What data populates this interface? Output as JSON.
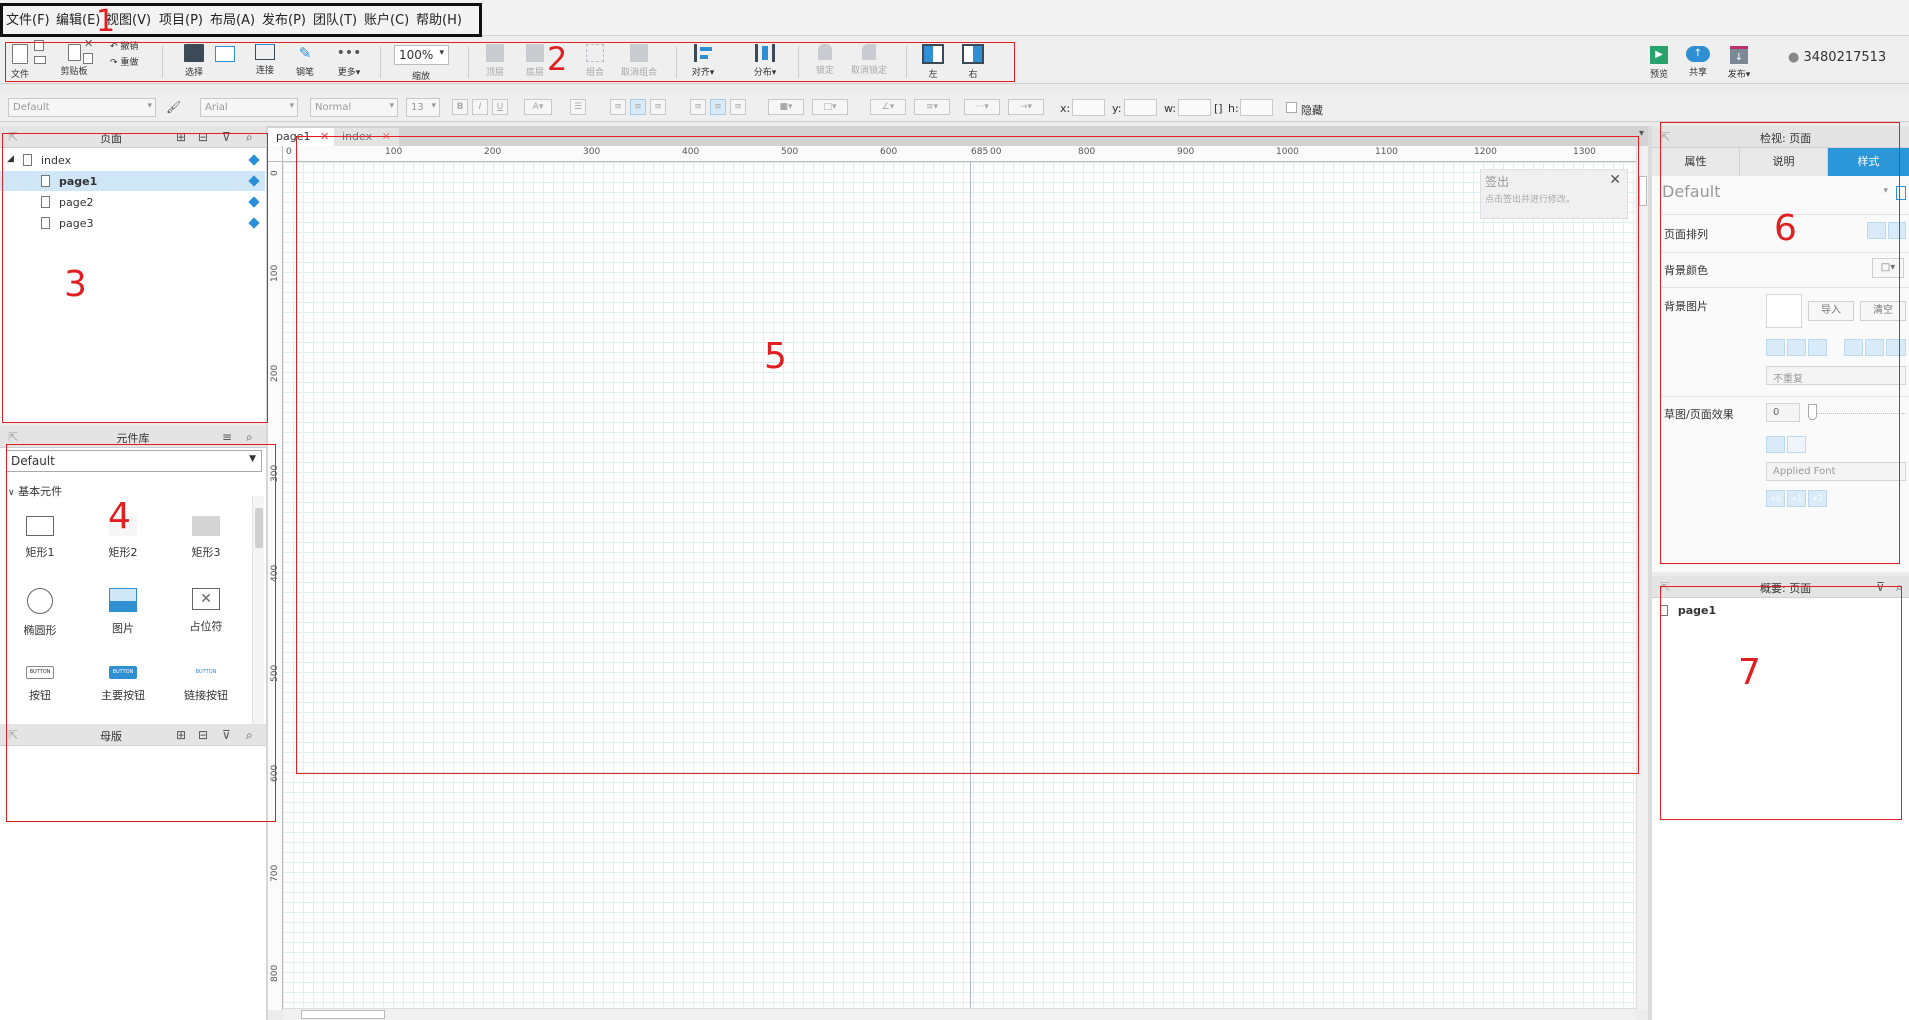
{
  "menu": [
    "文件(F)",
    "编辑(E)",
    "视图(V)",
    "项目(P)",
    "布局(A)",
    "发布(P)",
    "团队(T)",
    "账户(C)",
    "帮助(H)"
  ],
  "toolbar": {
    "file": "文件",
    "clipboard": "剪贴板",
    "undo": "撤销",
    "redo": "重做",
    "select": "选择",
    "connect": "连接",
    "pen": "钢笔",
    "more": "更多▾",
    "zoom_value": "100%",
    "zoom_label": "缩放",
    "top": "顶层",
    "bottom": "底层",
    "group": "组合",
    "ungroup": "取消组合",
    "align": "对齐▾",
    "distribute": "分布▾",
    "lock": "锁定",
    "unlock": "取消锁定",
    "left": "左",
    "right": "右",
    "preview": "预览",
    "share": "共享",
    "publish": "发布▾",
    "user": "3480217513"
  },
  "formatbar": {
    "style": "Default",
    "font": "Arial",
    "weight": "Normal",
    "size": "13",
    "x_label": "x:",
    "y_label": "y:",
    "w_label": "w:",
    "h_label": "h:",
    "hidden_label": "隐藏"
  },
  "pages_panel": {
    "title": "页面",
    "items": [
      {
        "label": "index",
        "level": 0,
        "selected": false,
        "bold": false
      },
      {
        "label": "page1",
        "level": 1,
        "selected": true,
        "bold": true
      },
      {
        "label": "page2",
        "level": 1,
        "selected": false,
        "bold": false
      },
      {
        "label": "page3",
        "level": 1,
        "selected": false,
        "bold": false
      }
    ]
  },
  "library_panel": {
    "title": "元件库",
    "selected_library": "Default",
    "group": "基本元件",
    "widgets": [
      "矩形1",
      "矩形2",
      "矩形3",
      "椭圆形",
      "图片",
      "占位符",
      "按钮",
      "主要按钮",
      "链接按钮"
    ],
    "button_text": "BUTTON"
  },
  "masters_panel": {
    "title": "母版"
  },
  "canvas": {
    "tabs": [
      {
        "label": "page1",
        "active": true
      },
      {
        "label": "index",
        "active": false
      }
    ],
    "ruler_x": [
      "0",
      "100",
      "200",
      "300",
      "400",
      "500",
      "600",
      "685",
      "00",
      "800",
      "900",
      "1000",
      "1100",
      "1200",
      "1300"
    ],
    "ruler_y": [
      "0",
      "100",
      "200",
      "300",
      "400",
      "500",
      "600",
      "700",
      "800"
    ],
    "notice_title": "签出",
    "notice_text": "点击签出并进行修改。"
  },
  "inspector": {
    "title": "检视: 页面",
    "tabs": [
      "属性",
      "说明",
      "样式"
    ],
    "active_tab": 2,
    "style_value": "Default",
    "page_align": "页面排列",
    "bg_color": "背景颜色",
    "bg_image": "背景图片",
    "import": "导入",
    "clear": "清空",
    "repeat": "不重复",
    "sketch_effect": "草图/页面效果",
    "sketch_value": "0",
    "font_value": "Applied Font",
    "steps": [
      "+0",
      "+1",
      "+2"
    ]
  },
  "outline": {
    "title": "概要: 页面",
    "item": "page1"
  },
  "annotations": [
    "1",
    "2",
    "3",
    "4",
    "5",
    "6",
    "7"
  ],
  "colors": {
    "accent": "#2f8fd3",
    "annotation": "#e02020",
    "active_tab": "#2b96d8"
  }
}
